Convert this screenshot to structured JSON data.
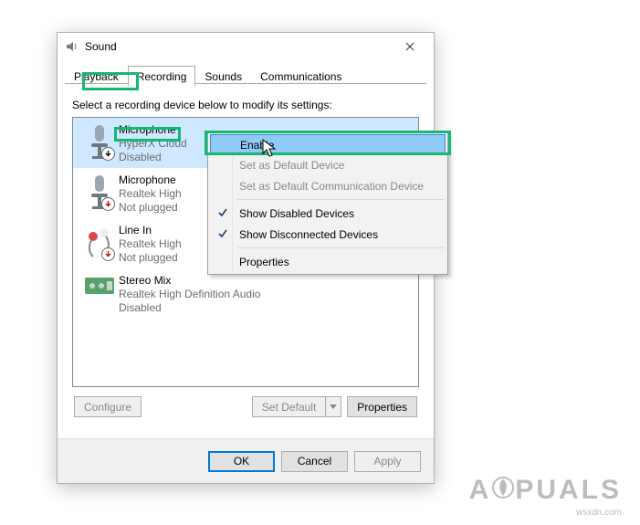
{
  "window": {
    "title": "Sound"
  },
  "tabs": {
    "playback": "Playback",
    "recording": "Recording",
    "sounds": "Sounds",
    "communications": "Communications"
  },
  "instruction": "Select a recording device below to modify its settings:",
  "devices": [
    {
      "name": "Microphone",
      "sub1": "HyperX Cloud",
      "sub2": "Disabled"
    },
    {
      "name": "Microphone",
      "sub1": "Realtek High",
      "sub2": "Not plugged"
    },
    {
      "name": "Line In",
      "sub1": "Realtek High",
      "sub2": "Not plugged"
    },
    {
      "name": "Stereo Mix",
      "sub1": "Realtek High Definition Audio",
      "sub2": "Disabled"
    }
  ],
  "buttons": {
    "configure": "Configure",
    "set_default": "Set Default",
    "properties": "Properties",
    "ok": "OK",
    "cancel": "Cancel",
    "apply": "Apply"
  },
  "menu": {
    "enable": "Enable",
    "set_default": "Set as Default Device",
    "set_comm": "Set as Default Communication Device",
    "show_disabled": "Show Disabled Devices",
    "show_disconnected": "Show Disconnected Devices",
    "properties": "Properties"
  },
  "watermark": {
    "brand": "A  PUALS",
    "site": "wsxdn.com"
  }
}
